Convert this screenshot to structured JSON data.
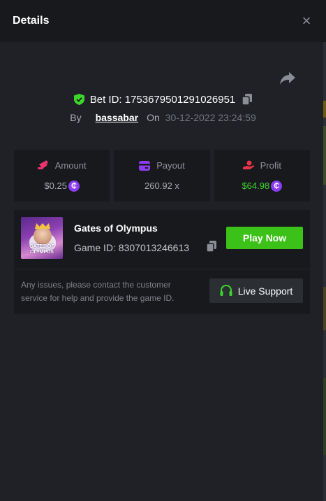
{
  "header": {
    "title": "Details",
    "close_icon": "×"
  },
  "bet": {
    "id_label": "Bet ID: 1753679501291026951",
    "by_label": "By",
    "user": "bassabar",
    "on_label": "On",
    "date": "30-12-2022 23:24:59"
  },
  "stats": [
    {
      "label": "Amount",
      "value": "$0.25",
      "icon": "amount-icon",
      "icon_color": "#e8346a",
      "coin": true,
      "value_color": "#a7aab1"
    },
    {
      "label": "Payout",
      "value": "260.92 x",
      "icon": "payout-card-icon",
      "icon_color": "#8b3cf0",
      "coin": false,
      "value_color": "#a7aab1"
    },
    {
      "label": "Profit",
      "value": "$64.98",
      "icon": "profit-hand-icon",
      "icon_color": "#e8344a",
      "coin": true,
      "value_color": "#3dd62c"
    }
  ],
  "coin_glyph": "₵",
  "game": {
    "title": "Gates of Olympus",
    "id_label": "Game ID: 8307013246613",
    "thumb_text": "GATES OF\nOLYMPUS",
    "play_label": "Play Now",
    "notice": "Any issues, please contact the customer service for help and provide the game ID.",
    "support_label": "Live Support"
  },
  "colors": {
    "background": "#1f2126",
    "header": "#18191d",
    "card": "#18191d",
    "play_button": "#3bc117",
    "coin": "#8b3cf0",
    "profit": "#3dd62c",
    "shield": "#3dd62c"
  }
}
